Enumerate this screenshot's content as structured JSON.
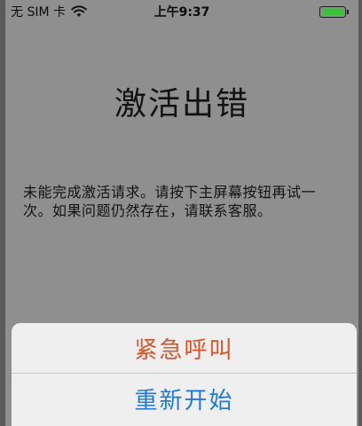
{
  "status_bar": {
    "carrier": "无 SIM 卡",
    "time": "上午9:37",
    "wifi_icon": "wifi-icon",
    "battery_icon": "battery-full-icon",
    "battery_color": "#3cc13b"
  },
  "main": {
    "title": "激活出错",
    "message": "未能完成激活请求。请按下主屏幕按钮再试一次。如果问题仍然存在，请联系客服。"
  },
  "action_sheet": {
    "emergency_label": "紧急呼叫",
    "restart_label": "重新开始",
    "emergency_color": "#d9542b",
    "restart_color": "#1f7ad6"
  },
  "colors": {
    "background_dim": "#8f8f8f",
    "sheet_background": "#efefef"
  }
}
